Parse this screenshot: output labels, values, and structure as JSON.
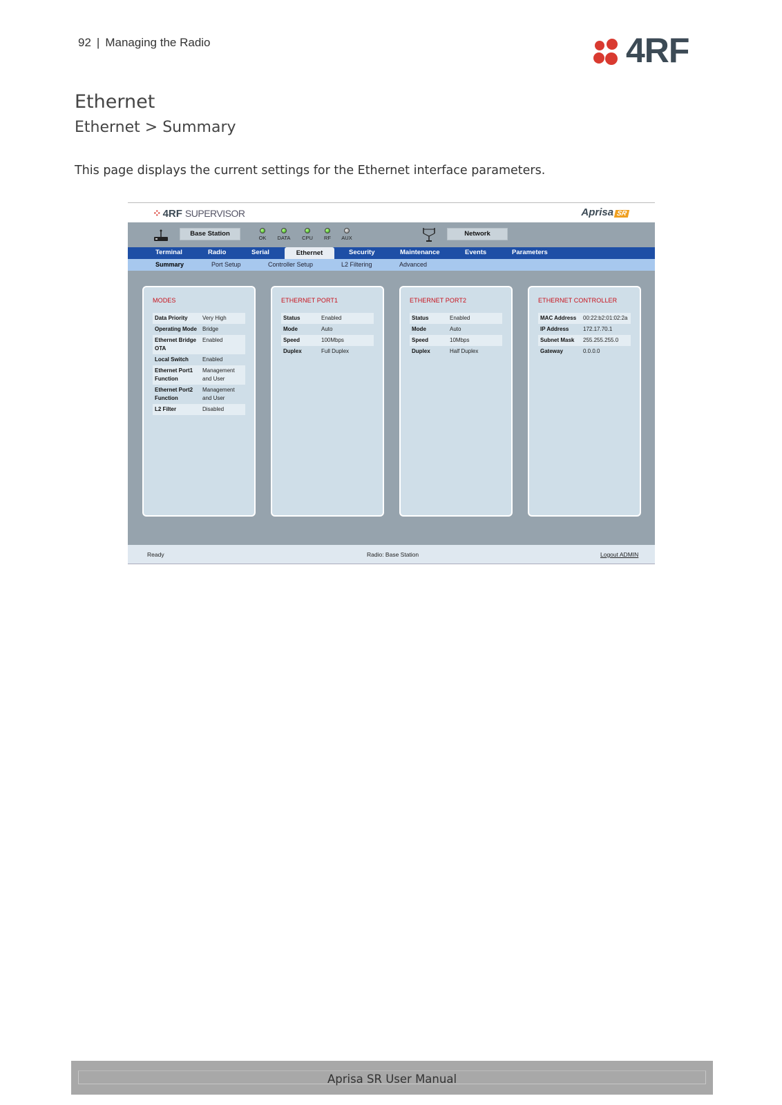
{
  "header": {
    "page_number": "92",
    "separator": "|",
    "section": "Managing the Radio",
    "logo_text": "4RF"
  },
  "doc": {
    "title": "Ethernet",
    "subtitle": "Ethernet > Summary",
    "paragraph": "This page displays the current settings for the Ethernet interface parameters."
  },
  "app": {
    "logo": "4RF",
    "logo_suffix": "SUPERVISOR",
    "product": "Aprisa",
    "product_badge": "SR",
    "station_label": "Base Station",
    "network_label": "Network",
    "leds": [
      {
        "label": "OK",
        "state": "on"
      },
      {
        "label": "DATA",
        "state": "on"
      },
      {
        "label": "CPU",
        "state": "on"
      },
      {
        "label": "RF",
        "state": "on"
      },
      {
        "label": "AUX",
        "state": "off"
      }
    ],
    "main_tabs": [
      "Terminal",
      "Radio",
      "Serial",
      "Ethernet",
      "Security",
      "Maintenance",
      "Events",
      "Parameters"
    ],
    "sub_tabs": [
      "Summary",
      "Port Setup",
      "Controller Setup",
      "L2 Filtering",
      "Advanced"
    ],
    "panels": {
      "modes": {
        "title": "MODES",
        "rows": [
          {
            "k": "Data Priority",
            "v": "Very High"
          },
          {
            "k": "Operating Mode",
            "v": "Bridge"
          },
          {
            "k": "Ethernet Bridge OTA",
            "v": "Enabled"
          },
          {
            "k": "Local Switch",
            "v": "Enabled"
          },
          {
            "k": "Ethernet Port1 Function",
            "v": "Management and User"
          },
          {
            "k": "Ethernet Port2 Function",
            "v": "Management and User"
          },
          {
            "k": "L2 Filter",
            "v": "Disabled"
          }
        ]
      },
      "port1": {
        "title": "ETHERNET PORT1",
        "rows": [
          {
            "k": "Status",
            "v": "Enabled"
          },
          {
            "k": "Mode",
            "v": "Auto"
          },
          {
            "k": "Speed",
            "v": "100Mbps"
          },
          {
            "k": "Duplex",
            "v": "Full Duplex"
          }
        ]
      },
      "port2": {
        "title": "ETHERNET PORT2",
        "rows": [
          {
            "k": "Status",
            "v": "Enabled"
          },
          {
            "k": "Mode",
            "v": "Auto"
          },
          {
            "k": "Speed",
            "v": "10Mbps"
          },
          {
            "k": "Duplex",
            "v": "Half Duplex"
          }
        ]
      },
      "controller": {
        "title": "ETHERNET CONTROLLER",
        "rows": [
          {
            "k": "MAC Address",
            "v": "00:22:b2:01:02:2a"
          },
          {
            "k": "IP Address",
            "v": "172.17.70.1"
          },
          {
            "k": "Subnet Mask",
            "v": "255.255.255.0"
          },
          {
            "k": "Gateway",
            "v": "0.0.0.0"
          }
        ]
      }
    },
    "footer": {
      "status": "Ready",
      "radio": "Radio: Base Station",
      "logout": "Logout ADMIN"
    }
  },
  "footer": {
    "text": "Aprisa SR User Manual"
  },
  "colors": {
    "accent_red": "#c8101a",
    "nav_blue": "#1e4fa6",
    "subnav_blue": "#a7c8ee",
    "panel_bg": "#cfdee8",
    "content_gray": "#96a3ad"
  }
}
